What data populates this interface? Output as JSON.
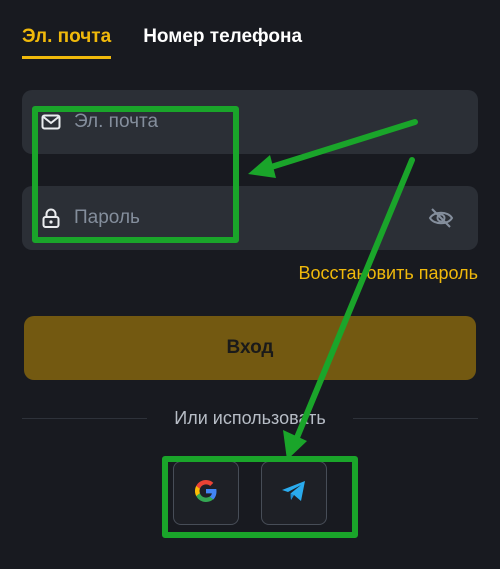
{
  "tabs": [
    {
      "label": "Эл. почта",
      "active": true
    },
    {
      "label": "Номер телефона",
      "active": false
    }
  ],
  "form": {
    "email_placeholder": "Эл. почта",
    "password_placeholder": "Пароль",
    "email_icon": "mail-icon",
    "password_icon": "lock-icon",
    "visibility_icon": "eye-off-icon",
    "forgot_label": "Восстановить пароль",
    "login_label": "Вход"
  },
  "alternate": {
    "label": "Или использовать",
    "providers": [
      "google-icon",
      "telegram-icon"
    ]
  },
  "annotations": {
    "highlight_color": "#1aa52a"
  },
  "colors": {
    "accent": "#f0b90b",
    "background": "#181a20",
    "field": "#2b2f36",
    "login_button": "#735911"
  }
}
